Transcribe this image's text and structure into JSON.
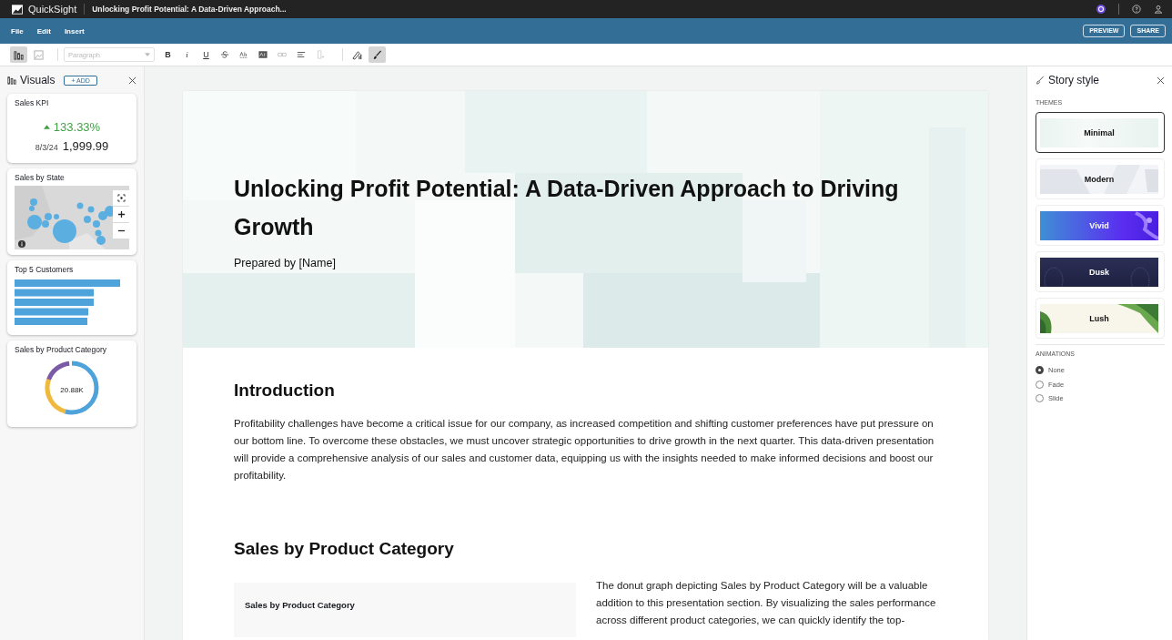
{
  "app": {
    "name": "QuickSight",
    "document_title": "Unlocking Profit Potential: A Data-Driven Approach..."
  },
  "menu": [
    "File",
    "Edit",
    "Insert"
  ],
  "actions": [
    "PREVIEW",
    "SHARE"
  ],
  "toolbar": {
    "view_tools": [
      {
        "kind": "visuals",
        "selected": true
      },
      {
        "kind": "image",
        "selected": false
      }
    ],
    "style_dropdown": {
      "placeholder": "Paragraph"
    },
    "format_tools": [
      {
        "kind": "bold",
        "label": "B"
      },
      {
        "kind": "italic",
        "label": "i"
      },
      {
        "kind": "underline",
        "label": "U"
      },
      {
        "kind": "strike"
      },
      {
        "kind": "spell"
      },
      {
        "kind": "highlight"
      },
      {
        "kind": "link"
      },
      {
        "kind": "align"
      },
      {
        "kind": "insert"
      }
    ],
    "panel_tools": [
      {
        "kind": "theme",
        "selected": false
      },
      {
        "kind": "brush",
        "selected": true
      }
    ]
  },
  "visuals_panel": {
    "title": "Visuals",
    "add_label": "+ ADD",
    "cards": [
      {
        "kind": "kpi",
        "title": "Sales KPI",
        "change": "133.33%",
        "date": "8/3/24",
        "value": "1,999.99"
      },
      {
        "kind": "map",
        "title": "Sales by State"
      },
      {
        "kind": "bars",
        "title": "Top 5 Customers"
      },
      {
        "kind": "donut",
        "title": "Sales by Product Category",
        "center_label": "20.88K"
      }
    ]
  },
  "story": {
    "title": "Unlocking Profit Potential: A Data-Driven Approach to Driving Growth",
    "subtitle": "Prepared by [Name]",
    "sections": [
      {
        "heading": "Introduction",
        "paragraph": "Profitability challenges have become a critical issue for our company, as increased competition and shifting customer preferences have put pressure on our bottom line. To overcome these obstacles, we must uncover strategic opportunities to drive growth in the next quarter. This data-driven presentation will provide a comprehensive analysis of our sales and customer data, equipping us with the insights needed to make informed decisions and boost our profitability."
      },
      {
        "heading": "Sales by Product Category",
        "visual_title": "Sales by Product Category",
        "paragraph": "The donut graph depicting Sales by Product Category will be a valuable addition to this presentation section. By visualizing the sales performance across different product categories, we can quickly identify the top-"
      }
    ]
  },
  "style_panel": {
    "title": "Story style",
    "themes_label": "THEMES",
    "themes": [
      {
        "kind": "minimal",
        "name": "Minimal",
        "selected": true
      },
      {
        "kind": "modern",
        "name": "Modern",
        "selected": false
      },
      {
        "kind": "vivid",
        "name": "Vivid",
        "selected": false
      },
      {
        "kind": "dusk",
        "name": "Dusk",
        "selected": false
      },
      {
        "kind": "lush",
        "name": "Lush",
        "selected": false
      }
    ],
    "animations_label": "ANIMATIONS",
    "animations": [
      {
        "label": "None",
        "selected": true
      },
      {
        "label": "Fade",
        "selected": false
      },
      {
        "label": "Slide",
        "selected": false
      }
    ]
  }
}
